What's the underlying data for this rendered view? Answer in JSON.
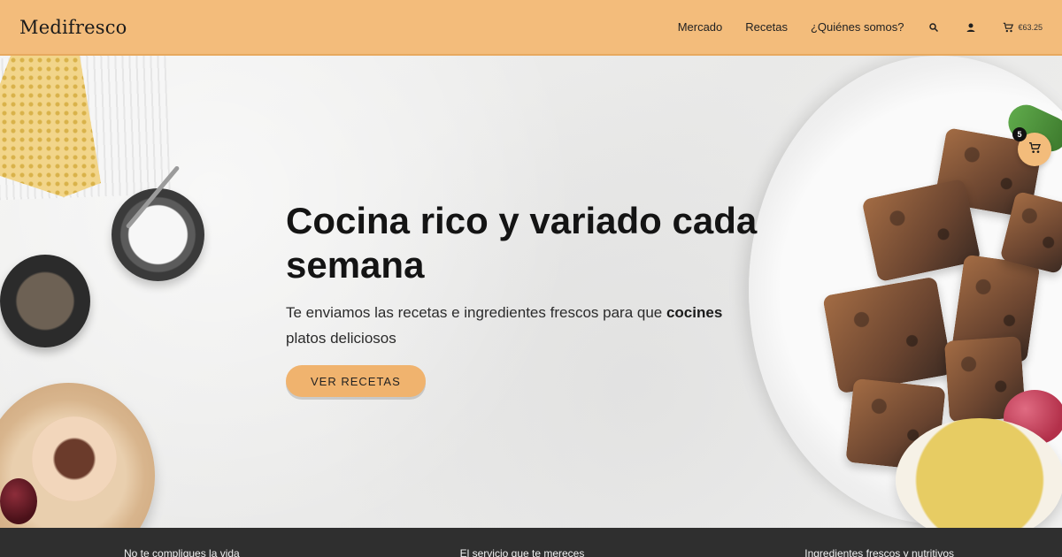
{
  "header": {
    "logo": "Medifresco",
    "nav": [
      "Mercado",
      "Recetas",
      "¿Quiénes somos?"
    ],
    "icons": [
      "search-icon",
      "user-icon",
      "cart-icon"
    ],
    "cart_amount": "€63.25",
    "background_color": "#f3bc7b"
  },
  "hero": {
    "title": "Cocina rico y variado cada semana",
    "subtitle_part1": "Te enviamos las recetas e ingredientes frescos para que ",
    "subtitle_bold": "cocines",
    "subtitle_part2": " platos deliciosos",
    "cta": "VER RECETAS",
    "cta_color": "#f0b36e"
  },
  "floating_cart": {
    "badge": "5",
    "icon": "cart-icon"
  },
  "features": [
    "No te compliques la vida",
    "El servicio que te mereces",
    "Ingredientes frescos y nutritivos"
  ]
}
